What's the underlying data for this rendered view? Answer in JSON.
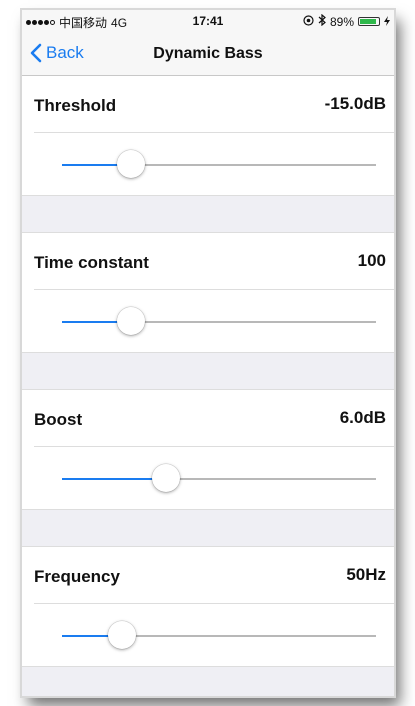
{
  "status_bar": {
    "carrier": "中国移动",
    "network": "4G",
    "time": "17:41",
    "battery_text": "89%",
    "battery_level": 0.89,
    "battery_color": "#2fb84b",
    "icons": [
      "signal-dots-icon",
      "location-icon",
      "bluetooth-icon",
      "battery-icon",
      "charging-icon"
    ]
  },
  "nav": {
    "back_label": "Back",
    "title": "Dynamic Bass"
  },
  "accent_color": "#1a7cf0",
  "settings": [
    {
      "label": "Threshold",
      "value": "-15.0dB",
      "slider_fraction": 0.22
    },
    {
      "label": "Time constant",
      "value": "100",
      "slider_fraction": 0.22
    },
    {
      "label": "Boost",
      "value": "6.0dB",
      "slider_fraction": 0.33
    },
    {
      "label": "Frequency",
      "value": "50Hz",
      "slider_fraction": 0.19
    }
  ]
}
